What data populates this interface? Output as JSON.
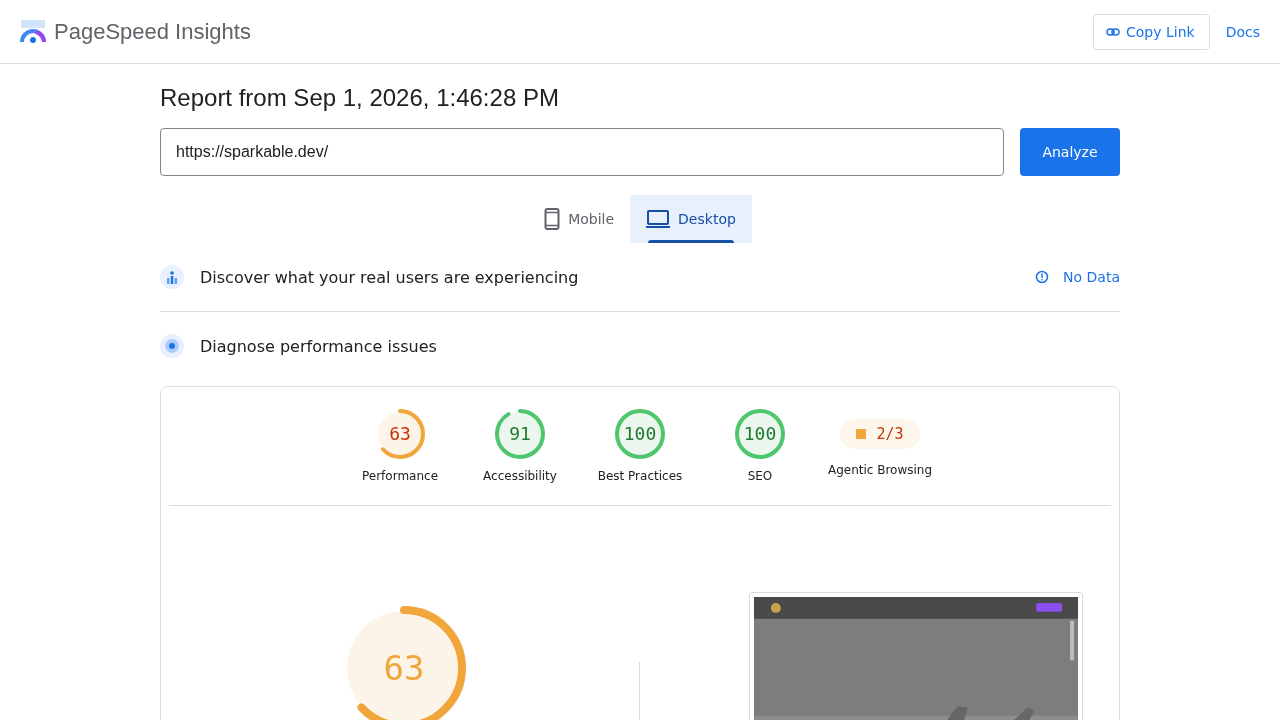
{
  "header": {
    "title": "PageSpeed Insights",
    "copy_link": "Copy Link",
    "docs": "Docs"
  },
  "report_title": "Report from Sep 1, 2026, 1:46:28 PM",
  "url_field": {
    "value": "https://sparkable.dev/"
  },
  "analyze_button": "Analyze",
  "device_tabs": [
    {
      "kind": "mobile",
      "label": "Mobile",
      "selected": false
    },
    {
      "kind": "desktop",
      "label": "Desktop",
      "selected": true
    }
  ],
  "field_data": {
    "title": "Discover what your real users are experiencing",
    "status": "No Data"
  },
  "lab_data": {
    "title": "Diagnose performance issues"
  },
  "categories": [
    {
      "kind": "gauge",
      "score": "63",
      "label": "Performance"
    },
    {
      "kind": "gauge",
      "score": "91",
      "label": "Accessibility"
    },
    {
      "kind": "gauge",
      "score": "100",
      "label": "Best Practices"
    },
    {
      "kind": "gauge",
      "score": "100",
      "label": "SEO"
    },
    {
      "kind": "badge",
      "score": "2/3",
      "label": "Agentic Browsing",
      "color": "#f0a63a"
    }
  ],
  "main_gauge": {
    "score": "63"
  }
}
